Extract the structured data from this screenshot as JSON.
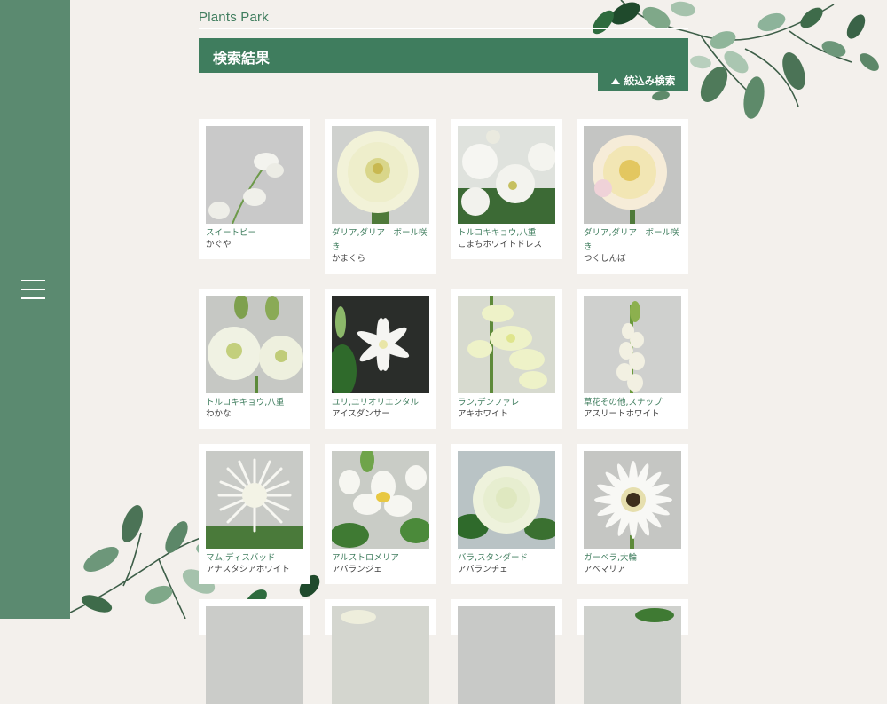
{
  "brand": "Plants Park",
  "results_title": "検索結果",
  "filter_label": "絞込み検索",
  "menu_icon": "hamburger-menu-icon",
  "colors": {
    "sidebar": "#5b8a70",
    "accent": "#3f7d5e",
    "background": "#f3f0ec"
  },
  "items": [
    {
      "type": "スイートピー",
      "name": "かぐや"
    },
    {
      "type": "ダリア,ダリア　ボール咲き",
      "name": "かまくら"
    },
    {
      "type": "トルコキキョウ,八重",
      "name": "こまちホワイトドレス"
    },
    {
      "type": "ダリア,ダリア　ボール咲き",
      "name": "つくしんぼ"
    },
    {
      "type": "トルコキキョウ,八重",
      "name": "わかな"
    },
    {
      "type": "ユリ,ユリオリエンタル",
      "name": "アイスダンサー"
    },
    {
      "type": "ラン,デンファレ",
      "name": "アキホワイト"
    },
    {
      "type": "草花その他,スナップ",
      "name": "アスリートホワイト"
    },
    {
      "type": "マム,ディスバッド",
      "name": "アナスタシアホワイト"
    },
    {
      "type": "アルストロメリア",
      "name": "アバランジェ"
    },
    {
      "type": "バラ,スタンダード",
      "name": "アバランチェ"
    },
    {
      "type": "ガーベラ,大輪",
      "name": "アベマリア"
    }
  ]
}
